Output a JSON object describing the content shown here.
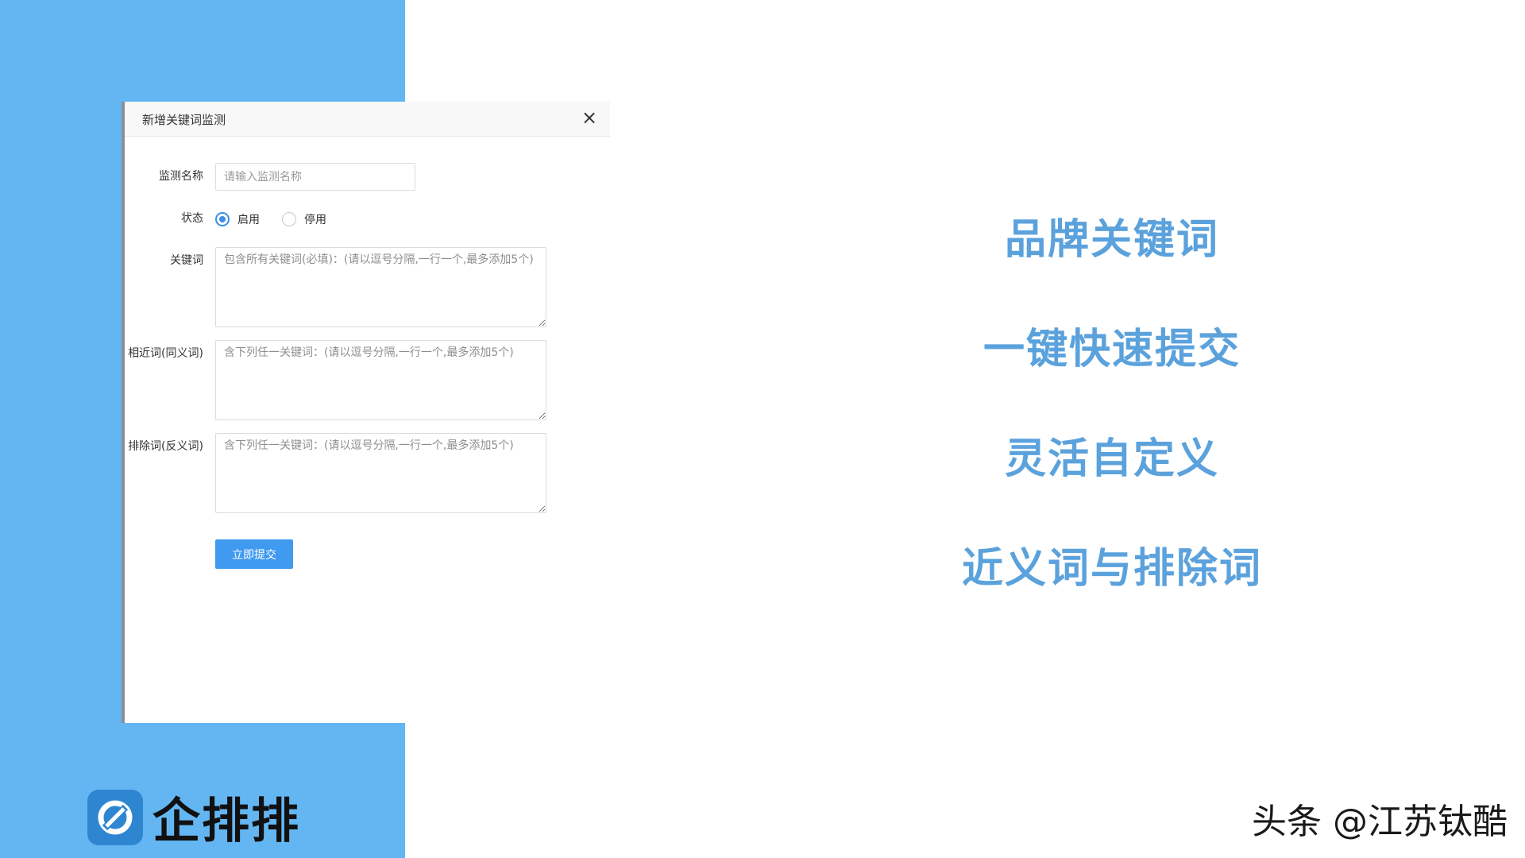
{
  "dialog": {
    "title": "新增关键词监测",
    "close_icon": "close-icon",
    "fields": {
      "name": {
        "label": "监测名称",
        "placeholder": "请输入监测名称"
      },
      "status": {
        "label": "状态",
        "options": [
          "启用",
          "停用"
        ],
        "selected": "启用"
      },
      "keywords": {
        "label": "关键词",
        "placeholder": "包含所有关键词(必填)：(请以逗号分隔,一行一个,最多添加5个)"
      },
      "synonyms": {
        "label": "相近词(同义词)",
        "placeholder": "含下列任一关键词：(请以逗号分隔,一行一个,最多添加5个)"
      },
      "exclusions": {
        "label": "排除词(反义词)",
        "placeholder": "含下列任一关键词：(请以逗号分隔,一行一个,最多添加5个)"
      }
    },
    "submit_label": "立即提交"
  },
  "features": [
    "品牌关键词",
    "一键快速提交",
    "灵活自定义",
    "近义词与排除词"
  ],
  "logo": {
    "text": "企排排",
    "icon": "qipaipai-logo-icon"
  },
  "watermark": "头条 @江苏钛酷",
  "colors": {
    "panel": "#63b6f2",
    "accent": "#3f9af0",
    "feature_text": "#5ba2dd"
  }
}
